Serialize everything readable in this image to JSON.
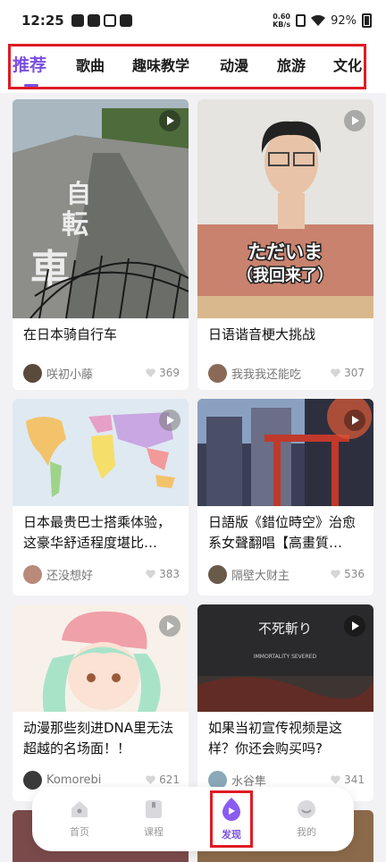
{
  "status_bar": {
    "time": "12:25",
    "net_speed_value": "0.60",
    "net_speed_unit": "KB/s",
    "battery": "92%"
  },
  "tabs": [
    {
      "label": "推荐",
      "active": true
    },
    {
      "label": "歌曲",
      "active": false
    },
    {
      "label": "趣味教学",
      "active": false
    },
    {
      "label": "动漫",
      "active": false
    },
    {
      "label": "旅游",
      "active": false
    },
    {
      "label": "文化",
      "active": false
    }
  ],
  "feed": {
    "cards": [
      {
        "title": "在日本骑自行车",
        "author": "咲初小藤",
        "likes": "369"
      },
      {
        "title": "日语谐音梗大挑战",
        "author": "我我我还能吃",
        "likes": "307",
        "thumb_caption_line1": "ただいま",
        "thumb_caption_line2": "（我回来了）"
      },
      {
        "title": "日本最贵巴士搭乘体验，这豪华舒适程度堪比…",
        "author": "还没想好",
        "likes": "383"
      },
      {
        "title": "日語版《錯位時空》治愈系女聲翻唱【高畫質…",
        "author": "隔壁大财主",
        "likes": "536"
      },
      {
        "title": "动漫那些刻进DNA里无法超越的名场面！！",
        "author": "Komorebi",
        "likes": "621"
      },
      {
        "title": "如果当初宣传视频是这样？你还会购买吗?",
        "author": "水谷隼",
        "likes": "341",
        "thumb_caption_line1": "不死斬り",
        "thumb_caption_line2": "IMMORTALITY SEVERED"
      }
    ]
  },
  "bottom_nav": [
    {
      "label": "首页",
      "icon": "home-icon"
    },
    {
      "label": "课程",
      "icon": "bookmark-icon"
    },
    {
      "label": "发现",
      "icon": "discover-icon",
      "active": true
    },
    {
      "label": "我的",
      "icon": "profile-icon"
    }
  ],
  "colors": {
    "accent": "#7b4fe0",
    "highlight_box": "#e01b24"
  }
}
